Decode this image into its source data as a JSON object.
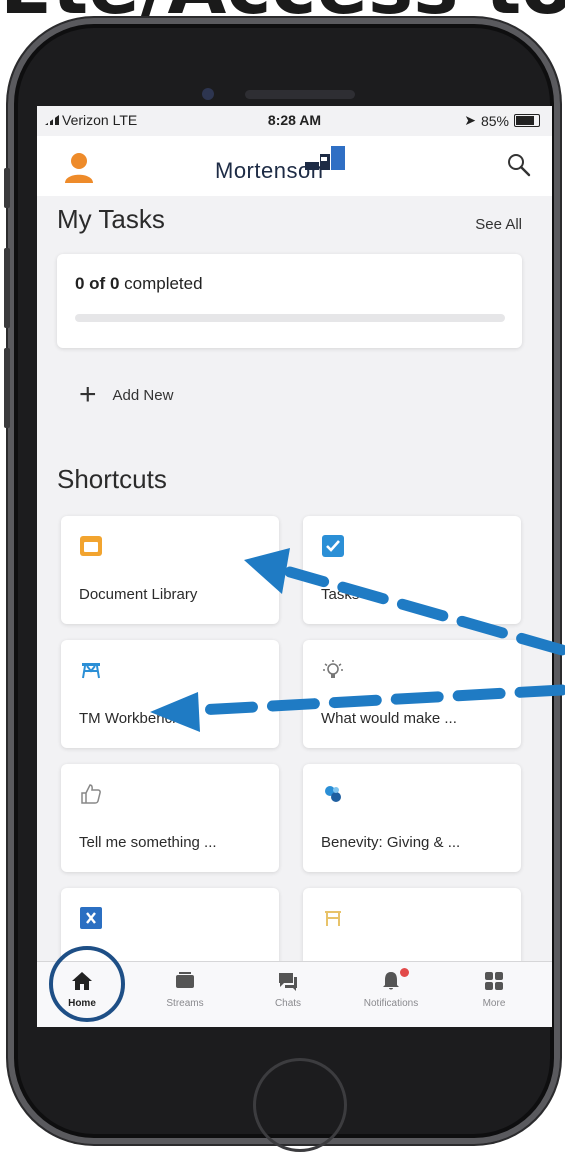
{
  "overlay_caption": "Ete/Access to",
  "status_bar": {
    "carrier": "Verizon  LTE",
    "time": "8:28 AM",
    "battery": "85%"
  },
  "header": {
    "logo_text": "Mortenson",
    "profile_icon": "person-icon",
    "search_icon": "search-icon"
  },
  "tasks": {
    "title": "My Tasks",
    "see_all": "See All",
    "completed_count": "0 of 0",
    "completed_suffix": " completed",
    "progress": 0.0,
    "add_new": "Add New"
  },
  "shortcuts": {
    "title": "Shortcuts",
    "items": [
      {
        "label": "Document Library",
        "icon": "folder-icon",
        "color": "#f2a42f"
      },
      {
        "label": "Tasks",
        "icon": "checkbox-icon",
        "color": "#2b8fd6"
      },
      {
        "label": "TM Workbench",
        "icon": "workbench-icon",
        "color": "#2b8fd6"
      },
      {
        "label": "What would make ...",
        "icon": "lightbulb-icon",
        "color": "#888888"
      },
      {
        "label": "Tell me something ...",
        "icon": "thumbs-up-icon",
        "color": "#888888"
      },
      {
        "label": "Benevity: Giving & ...",
        "icon": "benevity-icon",
        "color": "#2b8fd6"
      },
      {
        "label": "",
        "icon": "x-icon",
        "color": "#2b6fc2"
      },
      {
        "label": "",
        "icon": "sign-icon",
        "color": "#e8c36a"
      }
    ]
  },
  "tab_bar": {
    "items": [
      {
        "label": "Home",
        "icon": "home-icon",
        "active": true
      },
      {
        "label": "Streams",
        "icon": "streams-icon",
        "active": false
      },
      {
        "label": "Chats",
        "icon": "chat-icon",
        "active": false
      },
      {
        "label": "Notifications",
        "icon": "bell-icon",
        "active": false
      },
      {
        "label": "More",
        "icon": "grid-icon",
        "active": false
      }
    ]
  },
  "colors": {
    "accent": "#2b8fd6",
    "annotation": "#1f7bc4",
    "annotation_circle": "#1e4f86"
  }
}
